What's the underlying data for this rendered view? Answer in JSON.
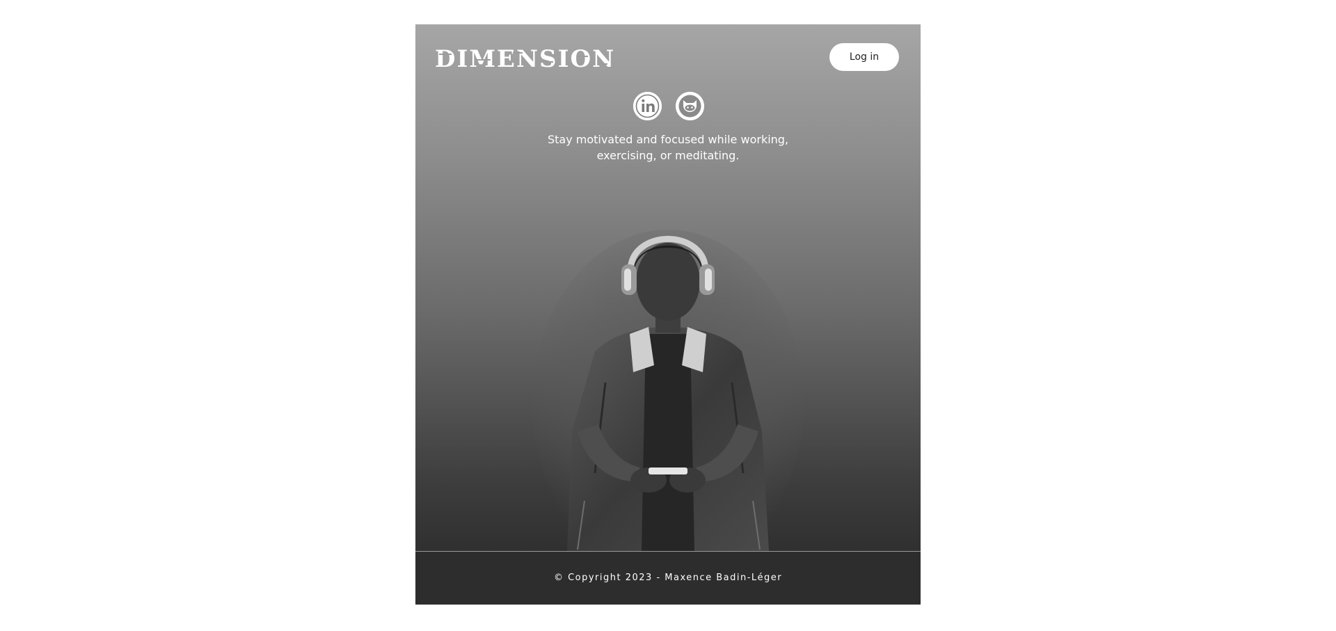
{
  "header": {
    "logo_text": "DIMENSION",
    "login_label": "Log in"
  },
  "socials": [
    {
      "name": "linkedin",
      "icon": "linkedin-icon"
    },
    {
      "name": "github",
      "icon": "github-icon"
    }
  ],
  "hero": {
    "tagline_line1": "Stay motivated and focused while working,",
    "tagline_line2": "exercising, or meditating.",
    "image": "person-with-headphones-looking-at-phone"
  },
  "footer": {
    "copyright": "© Copyright 2023 - Maxence Badin-Léger"
  },
  "colors": {
    "gradient_top": "#a6a6a6",
    "gradient_bottom": "#303030",
    "footer_bg": "#2d2d2d",
    "button_bg": "#ffffff",
    "text": "#ffffff"
  }
}
